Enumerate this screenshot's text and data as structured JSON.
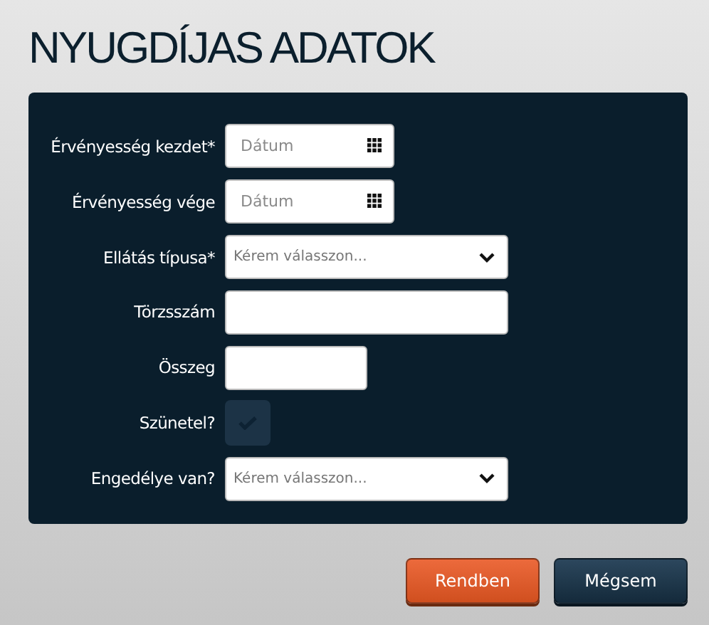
{
  "title": "NYUGDÍJAS ADATOK",
  "fields": [
    {
      "label": "Érvényesség kezdet*",
      "kind": "date",
      "placeholder": "Dátum"
    },
    {
      "label": "Érvényesség vége",
      "kind": "date",
      "placeholder": "Dátum"
    },
    {
      "label": "Ellátás típusa*",
      "kind": "select",
      "placeholder": "Kérem válasszon..."
    },
    {
      "label": "Törzsszám",
      "kind": "text"
    },
    {
      "label": "Összeg",
      "kind": "short"
    },
    {
      "label": "Szünetel?",
      "kind": "checkbox",
      "checked": false
    },
    {
      "label": "Engedélye van?",
      "kind": "select",
      "placeholder": "Kérem válasszon..."
    }
  ],
  "buttons": [
    {
      "label": "Rendben",
      "kind": "primary"
    },
    {
      "label": "Mégsem",
      "kind": "secondary"
    }
  ]
}
